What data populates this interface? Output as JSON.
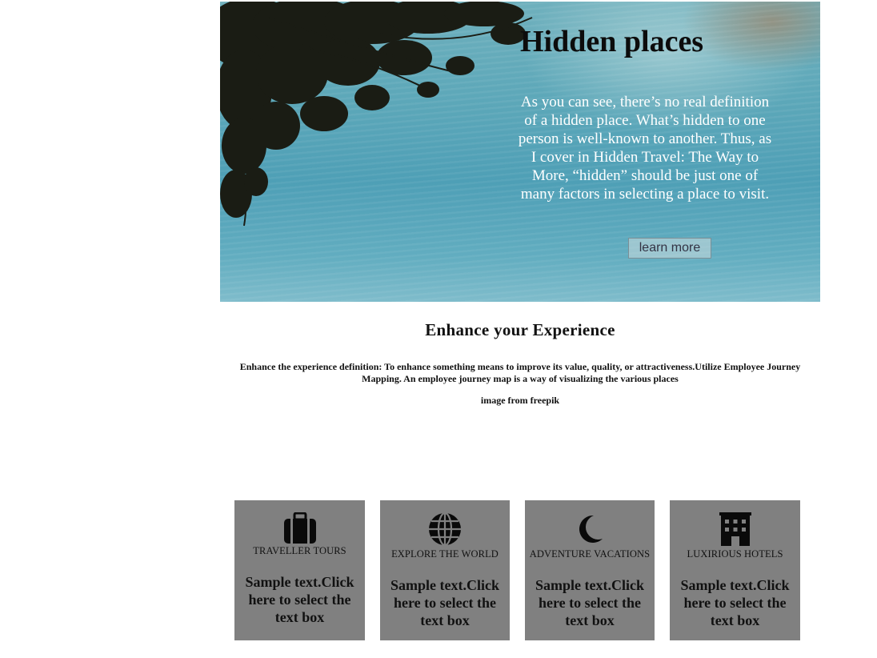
{
  "hero": {
    "title": "Hidden places",
    "text": "As you can see, there’s no real definition of a hidden place. What’s hidden to one person is well-known to another. Thus, as I cover in Hidden Travel: The Way to More, “hidden” should be just one of many factors in selecting a place to visit.",
    "button_label": "learn more"
  },
  "section": {
    "title": "Enhance your Experience",
    "description": "Enhance the experience definition: To enhance something means to improve its value, quality, or attractiveness.Utilize Employee Journey Mapping. An employee journey map is a way of visualizing the various places",
    "credit": "image from freepik"
  },
  "cards": [
    {
      "icon": "suitcase-icon",
      "label": "TRAVELLER TOURS",
      "body": "Sample text.Click here to select the text box"
    },
    {
      "icon": "globe-icon",
      "label": "EXPLORE THE WORLD",
      "body": "Sample text.Click here to select the text box"
    },
    {
      "icon": "moon-icon",
      "label": "ADVENTURE VACATIONS",
      "body": "Sample text.Click here to select the text box"
    },
    {
      "icon": "hotel-icon",
      "label": "LUXIRIOUS HOTELS",
      "body": "Sample text.Click here to select the text box"
    }
  ],
  "colors": {
    "card_background": "#808080",
    "water": "#5ea8b9"
  }
}
